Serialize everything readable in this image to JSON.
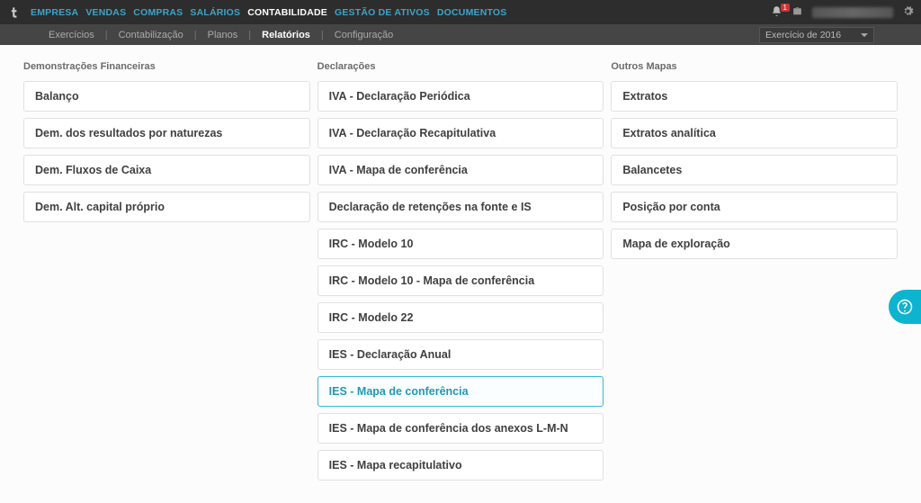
{
  "topnav": {
    "items": [
      {
        "label": "EMPRESA",
        "active": false
      },
      {
        "label": "VENDAS",
        "active": false
      },
      {
        "label": "COMPRAS",
        "active": false
      },
      {
        "label": "SALÁRIOS",
        "active": false
      },
      {
        "label": "CONTABILIDADE",
        "active": true
      },
      {
        "label": "GESTÃO DE ATIVOS",
        "active": false
      },
      {
        "label": "DOCUMENTOS",
        "active": false
      }
    ],
    "notification_count": "1"
  },
  "subnav": {
    "items": [
      {
        "label": "Exercícios",
        "active": false
      },
      {
        "label": "Contabilização",
        "active": false
      },
      {
        "label": "Planos",
        "active": false
      },
      {
        "label": "Relatórios",
        "active": true
      },
      {
        "label": "Configuração",
        "active": false
      }
    ],
    "year_selector": "Exercício de 2016"
  },
  "columns": {
    "financial": {
      "header": "Demonstrações Financeiras",
      "items": [
        "Balanço",
        "Dem. dos resultados por naturezas",
        "Dem. Fluxos de Caixa",
        "Dem. Alt. capital próprio"
      ]
    },
    "declarations": {
      "header": "Declarações",
      "items": [
        "IVA - Declaração Periódica",
        "IVA - Declaração Recapitulativa",
        "IVA - Mapa de conferência",
        "Declaração de retenções na fonte e IS",
        "IRC - Modelo 10",
        "IRC - Modelo 10 - Mapa de conferência",
        "IRC - Modelo 22",
        "IES - Declaração Anual",
        "IES - Mapa de conferência",
        "IES - Mapa de conferência dos anexos L-M-N",
        "IES - Mapa recapitulativo"
      ],
      "highlight_index": 8
    },
    "other": {
      "header": "Outros Mapas",
      "items": [
        "Extratos",
        "Extratos analítica",
        "Balancetes",
        "Posição por conta",
        "Mapa de exploração"
      ]
    }
  }
}
